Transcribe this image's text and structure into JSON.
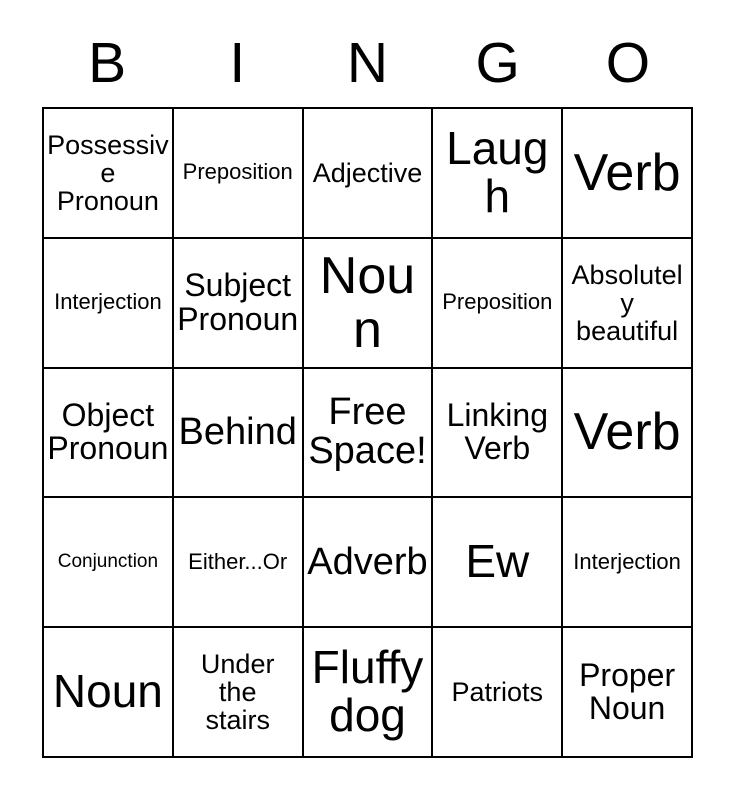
{
  "header": {
    "letters": [
      "B",
      "I",
      "N",
      "G",
      "O"
    ]
  },
  "grid": {
    "rows": 5,
    "columns": 5,
    "border_color": "#000000",
    "background_color": "#ffffff",
    "text_color": "#000000",
    "cells": [
      {
        "text": "Possessive\nPronoun",
        "size": "m"
      },
      {
        "text": "Preposition",
        "size": "s"
      },
      {
        "text": "Adjective",
        "size": "m"
      },
      {
        "text": "Laugh",
        "size": "xxl"
      },
      {
        "text": "Verb",
        "size": "xxxl"
      },
      {
        "text": "Interjection",
        "size": "s"
      },
      {
        "text": "Subject\nPronoun",
        "size": "l"
      },
      {
        "text": "Noun",
        "size": "xxxl"
      },
      {
        "text": "Preposition",
        "size": "s"
      },
      {
        "text": "Absolutely\nbeautiful",
        "size": "m"
      },
      {
        "text": "Object\nPronoun",
        "size": "l"
      },
      {
        "text": "Behind",
        "size": "xl"
      },
      {
        "text": "Free\nSpace!",
        "size": "xl"
      },
      {
        "text": "Linking\nVerb",
        "size": "l"
      },
      {
        "text": "Verb",
        "size": "xxxl"
      },
      {
        "text": "Conjunction",
        "size": "xs"
      },
      {
        "text": "Either...Or",
        "size": "s"
      },
      {
        "text": "Adverb",
        "size": "xl"
      },
      {
        "text": "Ew",
        "size": "xxl"
      },
      {
        "text": "Interjection",
        "size": "s"
      },
      {
        "text": "Noun",
        "size": "xxl"
      },
      {
        "text": "Under\nthe\nstairs",
        "size": "m"
      },
      {
        "text": "Fluffy\ndog",
        "size": "xxl"
      },
      {
        "text": "Patriots",
        "size": "m"
      },
      {
        "text": "Proper\nNoun",
        "size": "l"
      }
    ]
  }
}
